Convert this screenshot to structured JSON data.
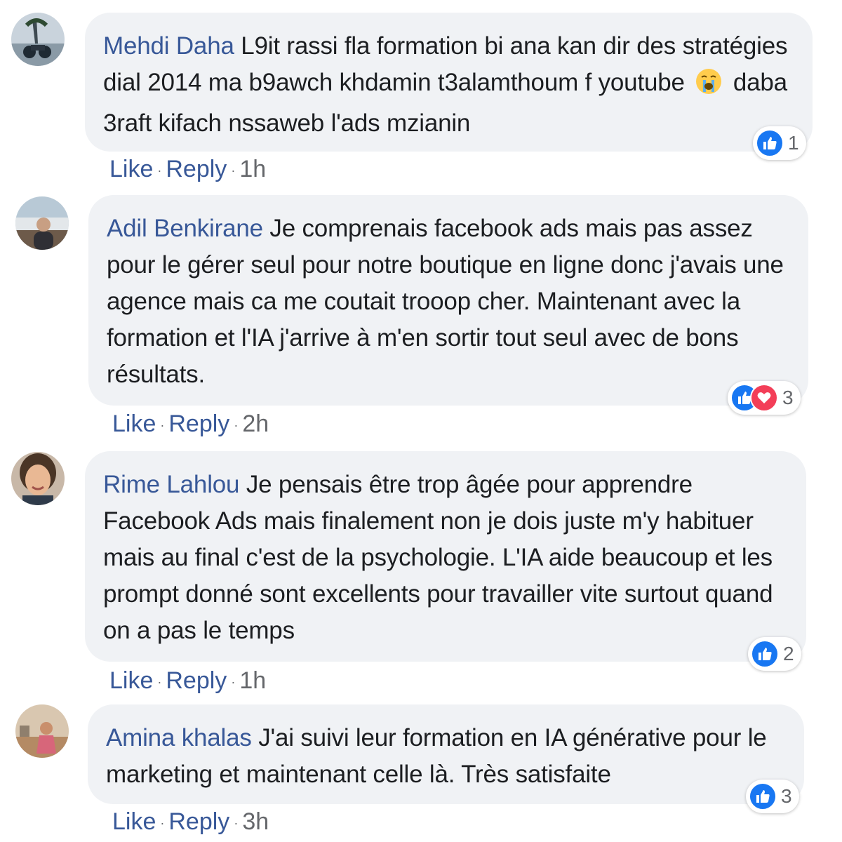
{
  "comments": [
    {
      "author": "Mehdi Daha",
      "text": "L9it rassi fla formation bi ana kan dir des stratégies dial 2014 ma b9awch khdamin t3alamthoum f youtube",
      "text_after_emoji": "daba 3raft kifach nssaweb l'ads mzianin",
      "emoji": "crying-face",
      "reactions": [
        "like"
      ],
      "reaction_count": "1",
      "actions": {
        "like": "Like",
        "reply": "Reply",
        "time": "1h"
      }
    },
    {
      "author": "Adil Benkirane",
      "text": "Je comprenais facebook ads mais pas assez pour le gérer seul pour notre boutique en ligne donc j'avais une agence mais ca me coutait trooop cher. Maintenant avec la formation et l'IA j'arrive à m'en sortir tout seul avec de bons résultats.",
      "reactions": [
        "like",
        "love"
      ],
      "reaction_count": "3",
      "actions": {
        "like": "Like",
        "reply": "Reply",
        "time": "2h"
      }
    },
    {
      "author": "Rime Lahlou",
      "text": "Je pensais être trop âgée pour apprendre Facebook Ads mais finalement non je dois juste m'y habituer mais au final c'est de la psychologie. L'IA aide beaucoup et les prompt donné sont excellents pour travailler vite surtout quand on a pas le temps",
      "reactions": [
        "like"
      ],
      "reaction_count": "2",
      "actions": {
        "like": "Like",
        "reply": "Reply",
        "time": "1h"
      }
    },
    {
      "author": "Amina khalas",
      "text": "J'ai suivi leur formation en IA générative pour le marketing et maintenant celle là. Très satisfaite",
      "reactions": [
        "like"
      ],
      "reaction_count": "3",
      "actions": {
        "like": "Like",
        "reply": "Reply",
        "time": "3h"
      }
    }
  ],
  "colors": {
    "bubble": "#f0f2f5",
    "author": "#385898",
    "text": "#1c1e21",
    "meta": "#65676b",
    "like": "#1877f2",
    "love": "#f33e58"
  },
  "separator": "·"
}
